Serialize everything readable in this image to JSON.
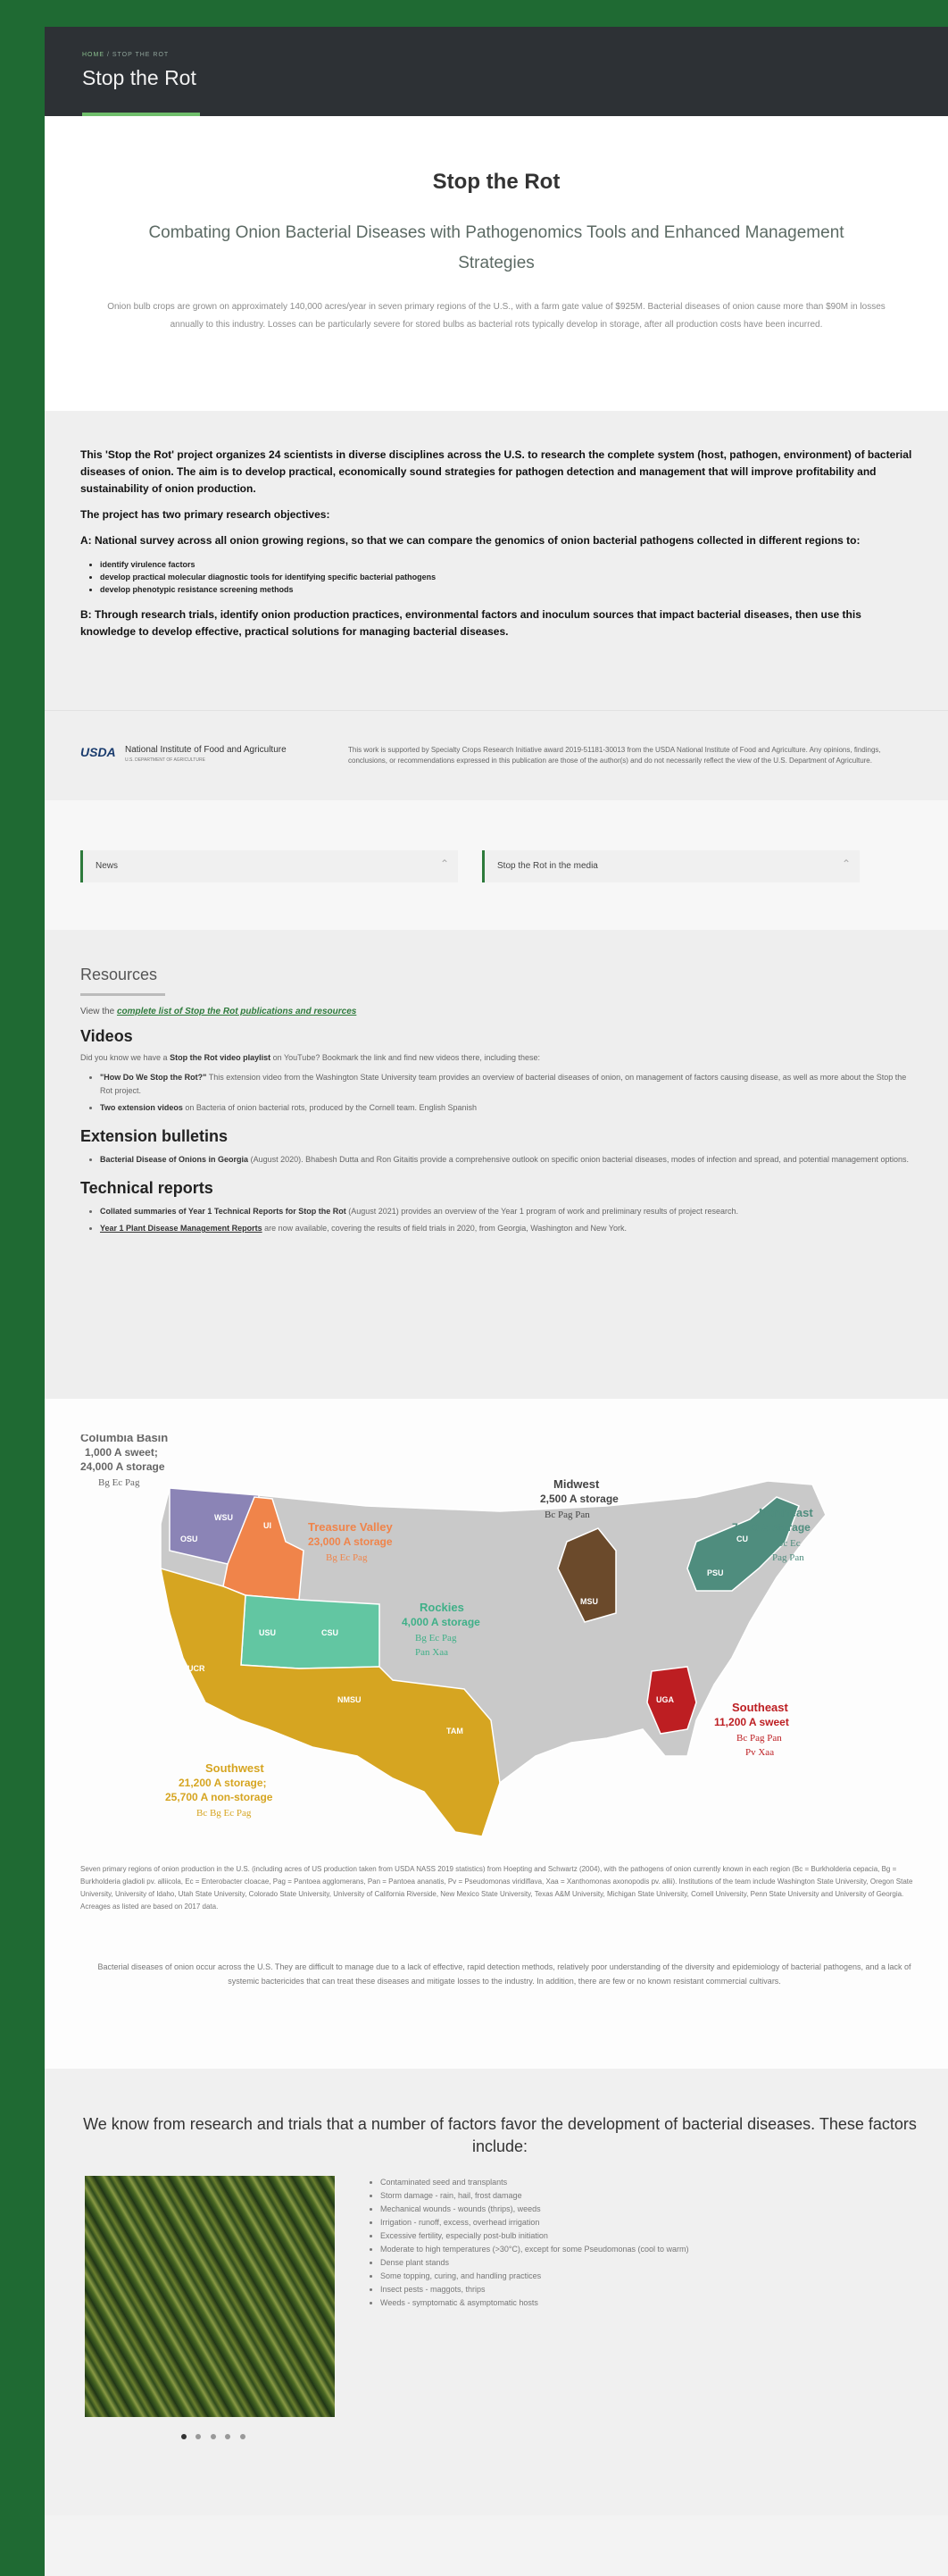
{
  "header": {
    "breadcrumb_home": "HOME",
    "breadcrumb_section": "STOP THE ROT",
    "site_title": "Stop the Rot"
  },
  "intro": {
    "title": "Stop the Rot",
    "subtitle": "Combating Onion Bacterial Diseases with Pathogenomics Tools and Enhanced Management Strategies",
    "body": "Onion bulb crops are grown on approximately 140,000 acres/year in seven primary regions of the U.S., with a farm gate value of $925M. Bacterial diseases of onion cause more than $90M in losses annually to this industry. Losses can be particularly severe for stored bulbs as bacterial rots typically develop in storage, after all production costs have been incurred."
  },
  "project": {
    "p1": "This 'Stop the Rot' project organizes 24 scientists in diverse disciplines across the U.S. to research the complete system (host, pathogen, environment) of bacterial diseases of onion. The aim is to develop practical, economically sound strategies for pathogen detection and management that will improve profitability and sustainability of onion production.",
    "p2": "The project has two primary research objectives:",
    "objA": "A: National survey across all onion growing regions, so that we can compare the genomics of onion bacterial pathogens collected in different regions to:",
    "bullets": [
      "identify virulence factors",
      "develop practical molecular diagnostic tools for identifying specific bacterial pathogens",
      "develop phenotypic resistance screening methods"
    ],
    "objB": "B: Through research trials, identify onion production practices, environmental factors and inoculum sources that impact bacterial diseases, then use this knowledge to develop effective, practical solutions for managing bacterial diseases."
  },
  "usda": {
    "logo": "USDA",
    "name": "National Institute of Food and Agriculture",
    "sub": "U.S. DEPARTMENT OF AGRICULTURE",
    "note": "This work is supported by Specialty Crops Research Initiative award 2019-51181-30013 from the USDA National Institute of Food and Agriculture. Any opinions, findings, conclusions, or recommendations expressed in this publication are those of the author(s) and do not necessarily reflect the view of the U.S. Department of Agriculture."
  },
  "accordions": [
    {
      "label": "News"
    },
    {
      "label": "Stop the Rot in the media"
    }
  ],
  "resources": {
    "title": "Resources",
    "view_prefix": "View the",
    "view_link": "complete list of Stop the Rot publications and resources",
    "videos_h": "Videos",
    "videos_p_prefix": "Did you know we have a",
    "videos_p_link": "Stop the Rot video playlist",
    "videos_p_suffix": "on YouTube? Bookmark the link and find new videos there, including these:",
    "videos_items": [
      {
        "b": "\"How Do We Stop the Rot?\"",
        "t": "This extension video from the Washington State University team provides an overview of bacterial diseases of onion, on management of factors causing disease, as well as more about the Stop the Rot project."
      },
      {
        "b": "Two extension videos",
        "t": "on Bacteria of onion bacterial rots, produced by the Cornell team. English Spanish"
      }
    ],
    "ext_h": "Extension bulletins",
    "ext_items": [
      {
        "b": "Bacterial Disease of Onions in Georgia",
        "t": "(August 2020). Bhabesh Dutta and Ron Gitaitis provide a comprehensive outlook on specific onion bacterial diseases, modes of infection and spread, and potential management options."
      }
    ],
    "tech_h": "Technical reports",
    "tech_items": [
      {
        "b": "Collated summaries of Year 1 Technical Reports for Stop the Rot",
        "t": "(August 2021) provides an overview of the Year 1 program of work and preliminary results of project research."
      },
      {
        "b": "Year 1 Plant Disease Management Reports",
        "t": "are now available, covering the results of field trials in 2020, from Georgia, Washington and New York."
      }
    ]
  },
  "map": {
    "regions": [
      {
        "name": "Columbia Basin",
        "l1": "1,000 A sweet;",
        "l2": "24,000 A storage",
        "l3": "Bg Ec Pag"
      },
      {
        "name": "Treasure Valley",
        "l1": "23,000 A storage",
        "l2": "Bg Ec Pag"
      },
      {
        "name": "Midwest",
        "l1": "2,500 A storage",
        "l2": "Bc Pag Pan"
      },
      {
        "name": "Northeast",
        "l1": "7,800 A storage",
        "l2": "Bc Ec",
        "l3": "Pag Pan"
      },
      {
        "name": "Rockies",
        "l1": "4,000 A storage",
        "l2": "Bg Ec Pag",
        "l3": "Pan Xaa"
      },
      {
        "name": "Southeast",
        "l1": "11,200 A sweet",
        "l2": "Bc Pag Pan",
        "l3": "Pv Xaa"
      },
      {
        "name": "Southwest",
        "l1": "21,200 A storage;",
        "l2": "25,700 A non-storage",
        "l3": "Bc Bg Ec Pag"
      }
    ],
    "univs": [
      "WSU",
      "OSU",
      "UI",
      "USU",
      "CSU",
      "UCR",
      "NMSU",
      "TAM",
      "MSU",
      "CU",
      "PSU",
      "UGA"
    ],
    "colors": {
      "base": "#c9c9c9",
      "columbia": "#8b84b6",
      "treasure": "#f0844a",
      "rockies": "#62c6a2",
      "southwest": "#d6a521",
      "midwest": "#6b4a2b",
      "northeast": "#4f8d7e",
      "southeast": "#bd1e22"
    },
    "caption": "Seven primary regions of onion production in the U.S. (including acres of US production taken from USDA NASS 2019 statistics) from Hoepting and Schwartz (2004), with the pathogens of onion currently known in each region (Bc = Burkholderia cepacia, Bg = Burkholderia gladioli pv. alliicola, Ec = Enterobacter cloacae, Pag = Pantoea agglomerans, Pan = Pantoea ananatis, Pv = Pseudomonas viridiflava, Xaa = Xanthomonas axonopodis pv. allii). Institutions of the team include Washington State University, Oregon State University, University of Idaho, Utah State University, Colorado State University, University of California Riverside, New Mexico State University, Texas A&M University, Michigan State University, Cornell University, Penn State University and University of Georgia. Acreages as listed are based on 2017 data.",
    "caption2": "Bacterial diseases of onion occur across the U.S. They are difficult to manage due to a lack of effective, rapid detection methods, relatively poor understanding of the diversity and epidemiology of bacterial pathogens, and a lack of systemic bactericides that can treat these diseases and mitigate losses to the industry. In addition, there are few or no known resistant commercial cultivars."
  },
  "factors": {
    "heading": "We know from research and trials that a number of factors favor the development of bacterial diseases. These factors include:",
    "items": [
      "Contaminated seed and transplants",
      "Storm damage - rain, hail, frost damage",
      "Mechanical wounds - wounds (thrips), weeds",
      "Irrigation - runoff, excess, overhead irrigation",
      "Excessive fertility, especially post-bulb initiation",
      "Moderate to high temperatures (>30°C), except for some Pseudomonas (cool to warm)",
      "Dense plant stands",
      "Some topping, curing, and handling practices",
      "Insect pests - maggots, thrips",
      "Weeds - symptomatic & asymptomatic hosts"
    ],
    "slides": 5
  }
}
